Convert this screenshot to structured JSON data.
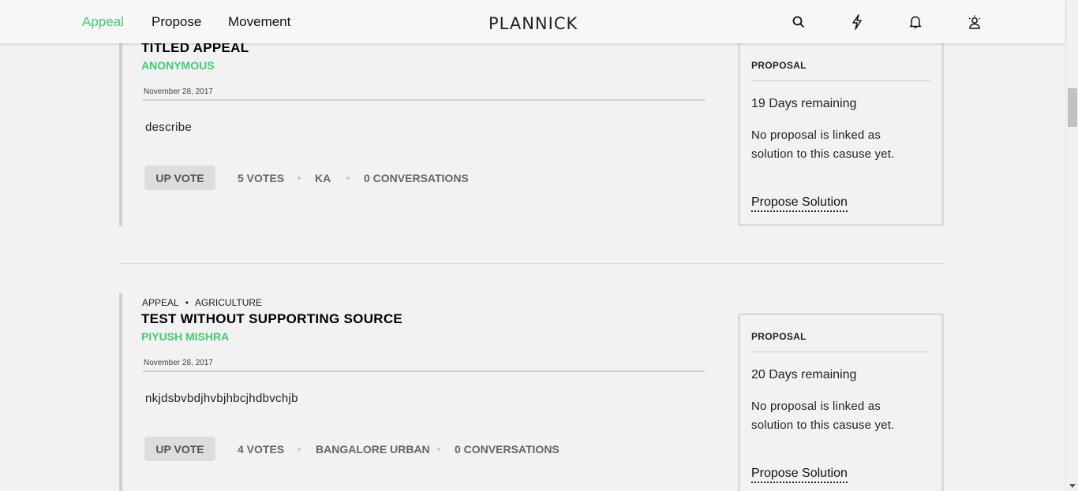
{
  "nav": {
    "items": [
      {
        "label": "Appeal",
        "active": true
      },
      {
        "label": "Propose",
        "active": false
      },
      {
        "label": "Movement",
        "active": false
      }
    ],
    "brand": "PLANNICK",
    "icons": [
      "search-icon",
      "lightning-icon",
      "bell-icon",
      "user-icon"
    ]
  },
  "colors": {
    "accent": "#3ecf6f",
    "tag_bg": "#dddddd"
  },
  "cards": [
    {
      "title": "TITLED APPEAL",
      "author": "ANONYMOUS",
      "date": "November 28, 2017",
      "description": "describe",
      "upvote_label": "UP VOTE",
      "votes": "5 VOTES",
      "location": "KA",
      "conversations": "0 CONVERSATIONS",
      "proposal": {
        "heading": "PROPOSAL",
        "days": "19 Days remaining",
        "text": "No proposal is linked as solution to this casuse yet.",
        "link": "Propose Solution"
      }
    },
    {
      "category": "APPEAL",
      "subcategory": "AGRICULTURE",
      "title": "TEST WITHOUT SUPPORTING SOURCE",
      "author": "PIYUSH MISHRA",
      "date": "November 28, 2017",
      "description": "nkjdsbvbdjhvbjhbcjhdbvchjb",
      "upvote_label": "UP VOTE",
      "votes": "4 VOTES",
      "location": "BANGALORE URBAN",
      "conversations": "0 CONVERSATIONS",
      "proposal": {
        "heading": "PROPOSAL",
        "days": "20 Days remaining",
        "text": "No proposal is linked as solution to this casuse yet.",
        "link": "Propose Solution"
      }
    }
  ]
}
